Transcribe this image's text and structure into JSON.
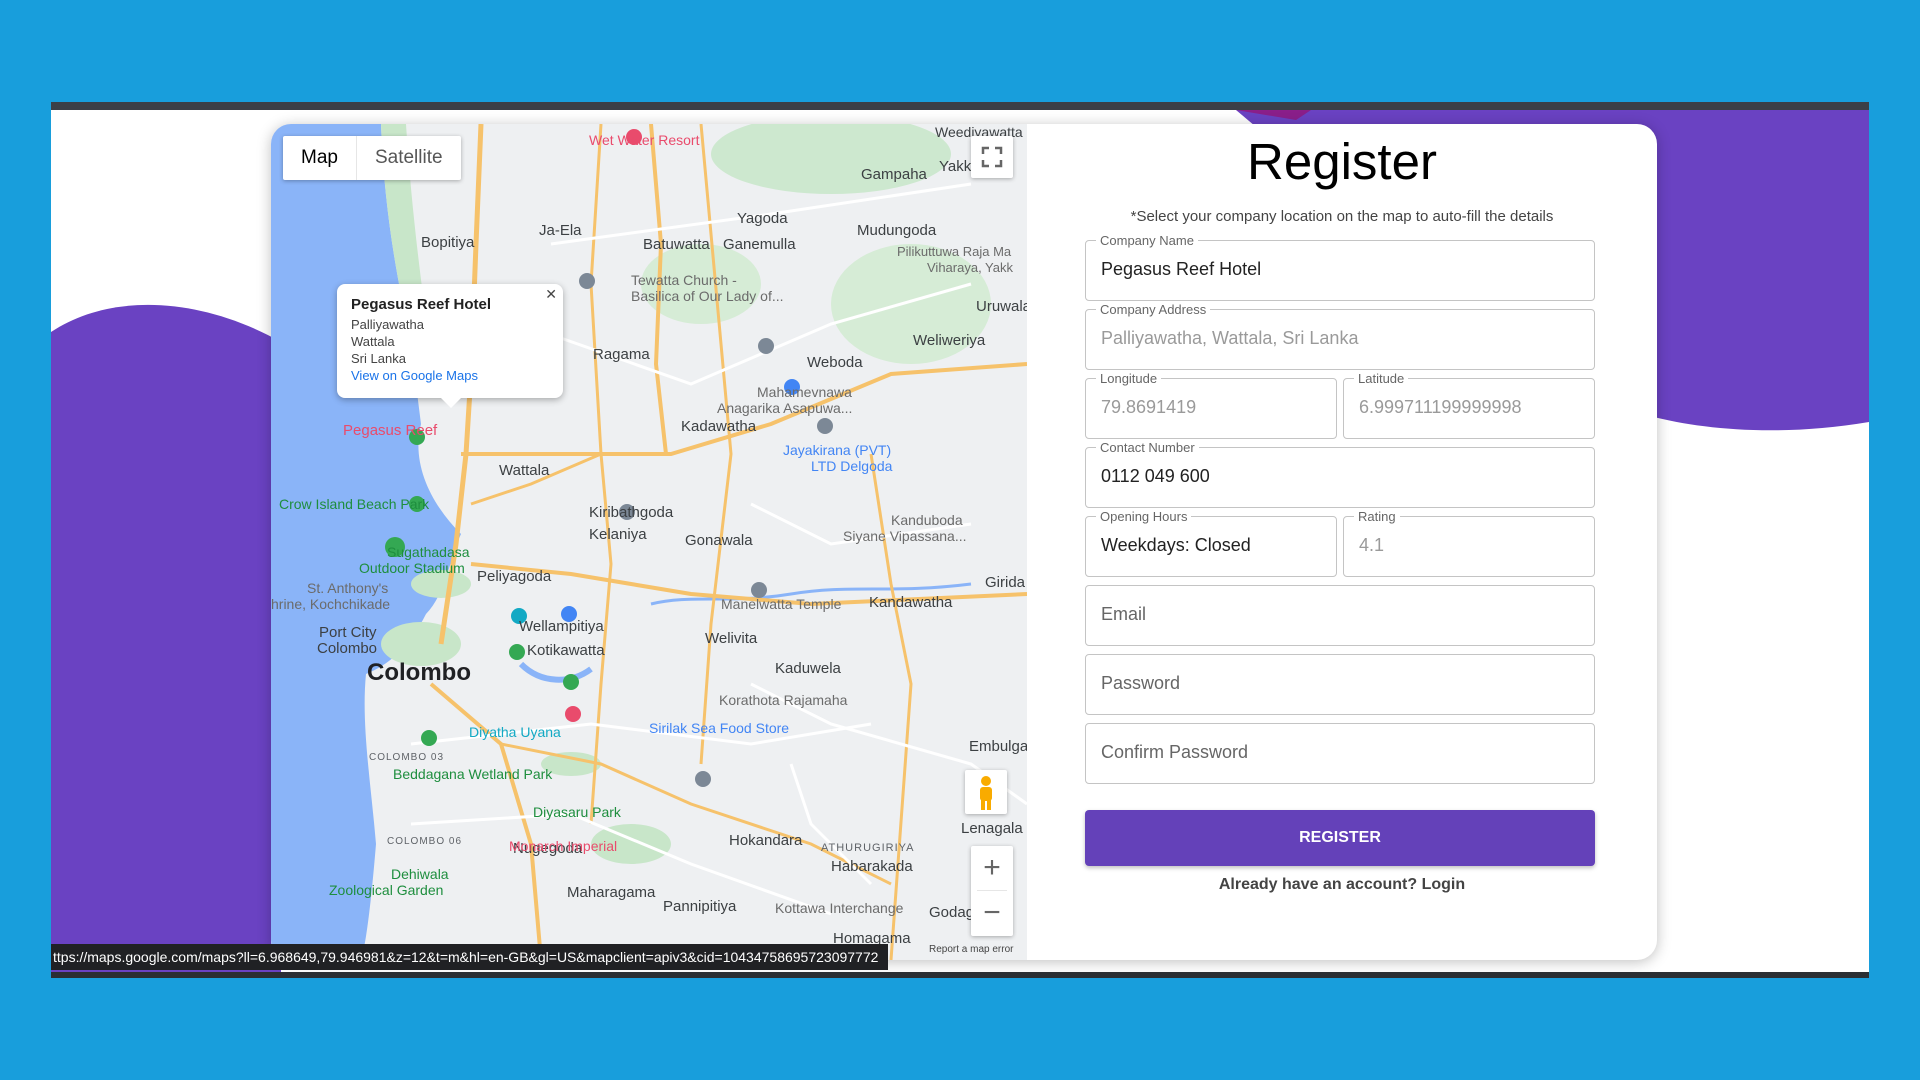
{
  "map": {
    "map_button": "Map",
    "satellite_button": "Satellite",
    "info_window": {
      "title": "Pegasus Reef Hotel",
      "line1": "Palliyawatha",
      "line2": "Wattala",
      "line3": "Sri Lanka",
      "link": "View on Google Maps"
    },
    "labels": {
      "colombo": "Colombo",
      "wattala": "Wattala",
      "ragama": "Ragama",
      "ja_ela": "Ja-Ela",
      "bopitiya": "Bopitiya",
      "batuwatta": "Batuwatta",
      "ganemulla": "Ganemulla",
      "yagoda": "Yagoda",
      "gampaha": "Gampaha",
      "mudungoda": "Mudungoda",
      "weboda": "Weboda",
      "weliweriya": "Weliweriya",
      "kadawatha": "Kadawatha",
      "kiribathgoda": "Kiribathgoda",
      "kelaniya": "Kelaniya",
      "gonawala": "Gonawala",
      "peliyagoda": "Peliyagoda",
      "wellampitiya": "Wellampitiya",
      "kotikawatta": "Kotikawatta",
      "welivita": "Welivita",
      "kaduwela": "Kaduwela",
      "kandawatha": "Kandawatha",
      "nugegoda": "Nugegoda",
      "maharagama": "Maharagama",
      "pannipitiya": "Pannipitiya",
      "hokandara": "Hokandara",
      "habarakada": "Habarakada",
      "lenagala": "Lenagala",
      "homagama": "Homagama",
      "pegasus_reef": "Pegasus Reef",
      "wet_water_resort": "Wet Water Resort",
      "crow_island": "Crow Island Beach Park",
      "sugathadasa": "Sugathadasa",
      "outdoor_stadium": "Outdoor Stadium",
      "port_city": "Port City",
      "port_city_2": "Colombo",
      "diyatha": "Diyatha Uyana",
      "sirilak": "Sirilak Sea Food Store",
      "beddagana": "Beddagana Wetland Park",
      "diyasaru": "Diyasaru Park",
      "monarch": "Monarch Imperial",
      "dehiwala": "Dehiwala",
      "zoological": "Zoological Garden",
      "manelwatta": "Manelwatta Temple",
      "korathota": "Korathota Rajamaha",
      "jayakirana": "Jayakirana (PVT)",
      "ltd_delgoda": "LTD Delgoda",
      "mahamevnawa": "Mahamevnawa",
      "anagarika": "Anagarika Asapuwa...",
      "tewatta": "Tewatta Church -",
      "basilica": "Basilica of Our Lady of...",
      "kandubodha": "Kanduboda",
      "siyane": "Siyane Vipassana...",
      "kottawa": "Kottawa Interchange",
      "godag": "Godag",
      "embulga": "Embulga",
      "girida": "Girida",
      "uruwala": "Uruwala",
      "yakk": "Yakk",
      "weediyawatta": "Weediyawatta",
      "pilikuttuwa": "Pilikuttuwa Raja Ma",
      "viharaya": "Viharaya, Yakk",
      "st_anthony": "St. Anthony's",
      "kochchikade": "hrine, Kochchikade",
      "athurugiriya": "ATHURUGIRIYA",
      "colombo_03": "COLOMBO 03",
      "colombo_06": "COLOMBO 06"
    },
    "report_link": "Report a map error",
    "status_url": "ttps://maps.google.com/maps?ll=6.968649,79.946981&z=12&t=m&hl=en-GB&gl=US&mapclient=apiv3&cid=10434758695723097772"
  },
  "form": {
    "title": "Register",
    "hint": "*Select your company location on the map to auto-fill the details",
    "company_name": {
      "label": "Company Name",
      "value": "Pegasus Reef Hotel"
    },
    "company_address": {
      "label": "Company Address",
      "value": "Palliyawatha, Wattala, Sri Lanka"
    },
    "longitude": {
      "label": "Longitude",
      "value": "79.8691419"
    },
    "latitude": {
      "label": "Latitude",
      "value": "6.999711199999998"
    },
    "contact_number": {
      "label": "Contact Number",
      "value": "0112 049 600"
    },
    "opening_hours": {
      "label": "Opening Hours",
      "value": "Weekdays: Closed"
    },
    "rating": {
      "label": "Rating",
      "value": "4.1"
    },
    "email_placeholder": "Email",
    "password_placeholder": "Password",
    "confirm_password_placeholder": "Confirm Password",
    "register_button": "REGISTER",
    "login_link": "Already have an account? Login"
  },
  "colors": {
    "accent": "#6441b9",
    "background": "#189edc",
    "deco_purple": "#6a42c2"
  }
}
